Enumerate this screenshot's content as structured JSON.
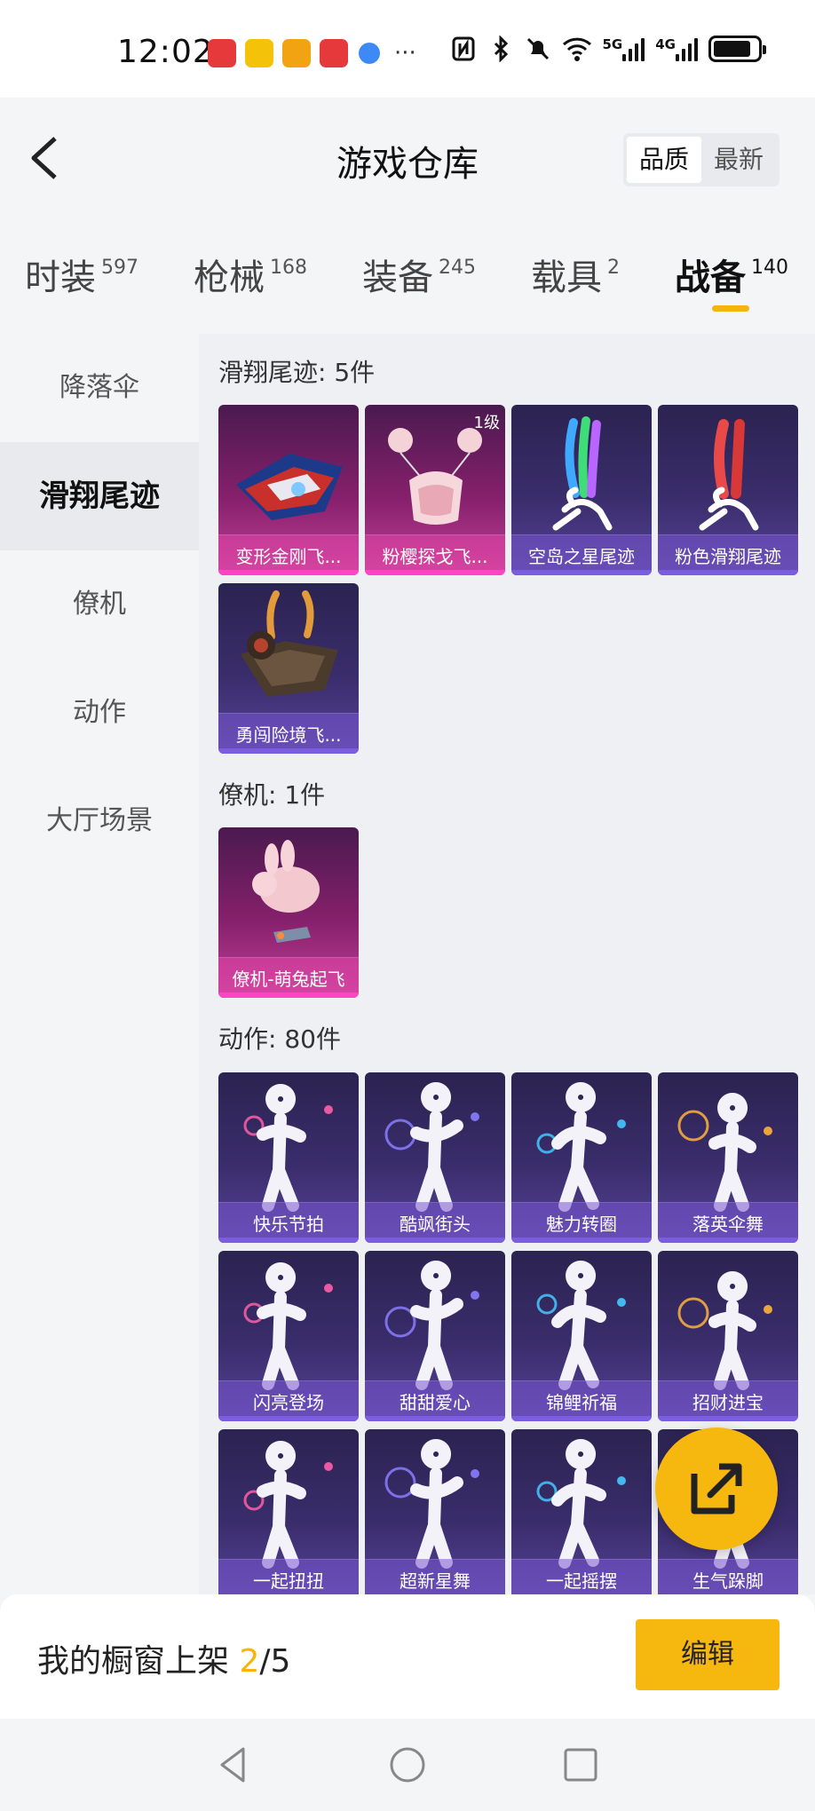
{
  "status_bar": {
    "time": "12:02",
    "signal1_label": "5G",
    "signal2_label": "4G",
    "battery_level": 0.85,
    "icons": [
      "huawei-app-icon",
      "taobao-app-icon",
      "game-app-icon",
      "huawei-app-icon",
      "browser-icon",
      "more-icon",
      "nfc-icon",
      "bluetooth-icon",
      "mute-icon",
      "wifi-icon",
      "signal-icon",
      "battery-icon"
    ]
  },
  "header": {
    "title": "游戏仓库",
    "sort_options": [
      "品质",
      "最新"
    ],
    "sort_active": "品质"
  },
  "categories": [
    {
      "label": "时装",
      "count": "597"
    },
    {
      "label": "枪械",
      "count": "168"
    },
    {
      "label": "装备",
      "count": "245"
    },
    {
      "label": "载具",
      "count": "2"
    },
    {
      "label": "战备",
      "count": "140"
    }
  ],
  "active_category": "战备",
  "sidebar": {
    "items": [
      "降落伞",
      "滑翔尾迹",
      "僚机",
      "动作",
      "大厅场景"
    ],
    "active": "滑翔尾迹"
  },
  "sections": {
    "trail": {
      "title": "滑翔尾迹: 5件",
      "items": [
        {
          "name": "变形金刚飞...",
          "badge": "",
          "style": "pink"
        },
        {
          "name": "粉樱探戈飞...",
          "badge": "1级",
          "style": "pink"
        },
        {
          "name": "空岛之星尾迹",
          "badge": "",
          "style": "purple"
        },
        {
          "name": "粉色滑翔尾迹",
          "badge": "",
          "style": "purple"
        },
        {
          "name": "勇闯险境飞...",
          "badge": "",
          "style": "purple"
        }
      ]
    },
    "wingman": {
      "title": "僚机: 1件",
      "items": [
        {
          "name": "僚机-萌兔起飞",
          "badge": "",
          "style": "pink"
        }
      ]
    },
    "emote": {
      "title": "动作: 80件",
      "items": [
        {
          "name": "快乐节拍"
        },
        {
          "name": "酷飒街头"
        },
        {
          "name": "魅力转圈"
        },
        {
          "name": "落英伞舞"
        },
        {
          "name": "闪亮登场"
        },
        {
          "name": "甜甜爱心"
        },
        {
          "name": "锦鲤祈福"
        },
        {
          "name": "招财进宝"
        },
        {
          "name": "一起扭扭"
        },
        {
          "name": "超新星舞"
        },
        {
          "name": "一起摇摆"
        },
        {
          "name": "生气跺脚"
        }
      ]
    }
  },
  "bottom": {
    "shelf_label": "我的橱窗上架 ",
    "shelf_current": "2",
    "shelf_total": "/5",
    "edit_label": "编辑"
  },
  "colors": {
    "accent": "#f6b70e",
    "tile_purple": "#3a2d6c",
    "tile_pink": "#86206c"
  }
}
